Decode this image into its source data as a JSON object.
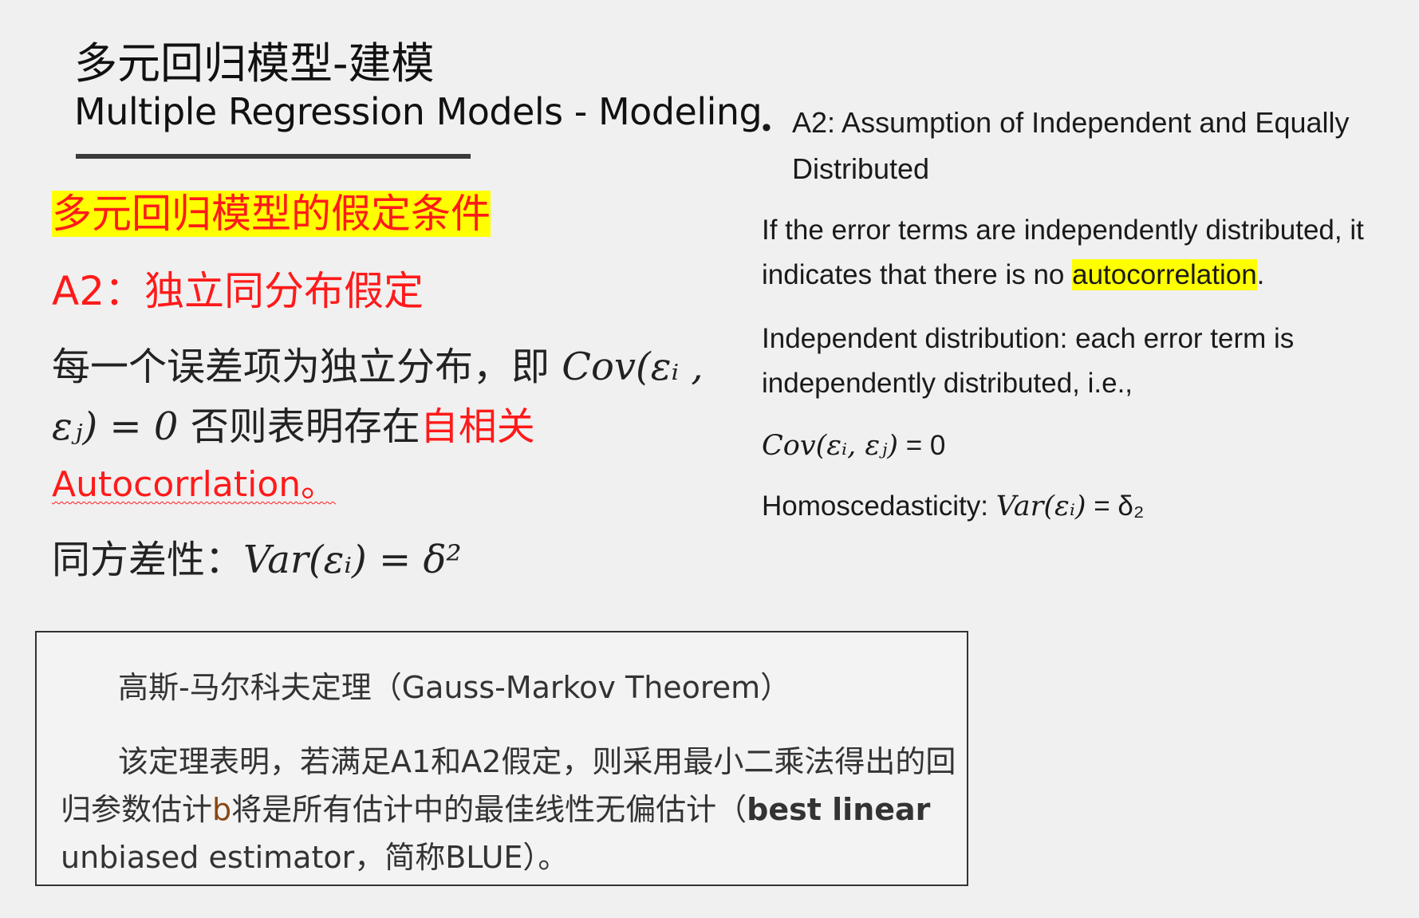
{
  "title": {
    "cn": "多元回归模型-建模",
    "en": "Multiple Regression Models - Modeling"
  },
  "left": {
    "assumption_heading": "多元回归模型的假定条件",
    "a2_heading": "A2：独立同分布假定",
    "line1_text": "每一个误差项为独立分布，即",
    "line1_math": "Cov(εᵢ ,",
    "line2_math": "εⱼ) = 0",
    "line2_text": " 否则表明存在",
    "line2_red": "自相关",
    "autocorr_word": "Autocorrlation",
    "autocorr_period": "。",
    "homo_label": "同方差性：",
    "homo_math": "Var(εᵢ) = δ²"
  },
  "right": {
    "bullet": "•",
    "a2_title_line1": "A2: Assumption of Independent and Equally",
    "a2_title_line2": "Distributed",
    "p1_line1": "If the error terms are independently distributed, it",
    "p1_line2_pre": "indicates that there is no ",
    "p1_line2_hl": "autocorrelation",
    "p1_line2_post": ".",
    "p2_line1": "Independent distribution: each error term is",
    "p2_line2": "independently distributed, i.e.,",
    "cov_math": "Cov(εᵢ, εⱼ)",
    "cov_rest": " = 0",
    "homo_label": "Homoscedasticity: ",
    "homo_math": "Var(εᵢ)",
    "homo_rest": " = δ₂"
  },
  "gauss_markov": {
    "title": "高斯-马尔科夫定理（Gauss-Markov Theorem）",
    "line1": "该定理表明，若满足A1和A2假定，则采用最小二乘法得出的回",
    "line2_pre": "归参数估计",
    "line2_b": "b",
    "line2_post": "将是所有估计中的最佳线性无偏估计（",
    "line2_en": "best linear",
    "line3": "unbiased estimator，简称BLUE）。"
  }
}
